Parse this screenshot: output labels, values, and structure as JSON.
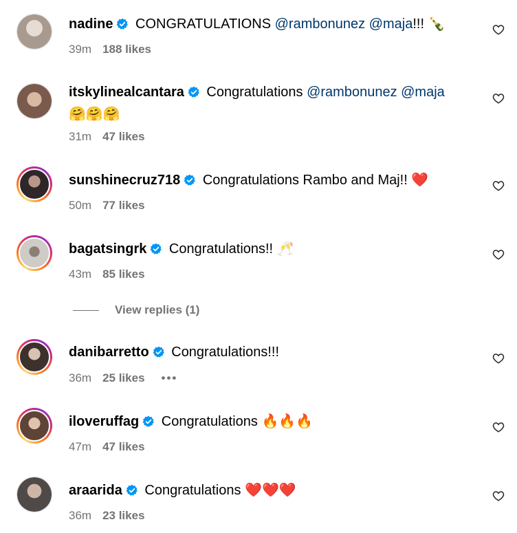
{
  "comments": [
    {
      "username": "nadine",
      "text": " CONGRATULATIONS ",
      "mentions": [
        "@rambonunez",
        "@maja"
      ],
      "suffix": "!!! ",
      "emoji": "🍾",
      "time": "39m",
      "likes": "188 likes",
      "avatar_color": "#c8c2bc"
    },
    {
      "username": "itskylinealcantara",
      "text": " Congratulations ",
      "mentions": [
        "@rambonunez",
        "@maja"
      ],
      "emoji": "🤗🤗🤗",
      "time": "31m",
      "likes": "47 likes",
      "avatar_color": "#9a7b6a"
    },
    {
      "username": "sunshinecruz718",
      "text": " Congratulations Rambo and Maj!! ",
      "emoji": "❤️",
      "time": "50m",
      "likes": "77 likes",
      "avatar_color": "#3a2f33"
    },
    {
      "username": "bagatsingrk",
      "text": " Congratulations!! ",
      "emoji": "🥂",
      "time": "43m",
      "likes": "85 likes",
      "avatar_color": "#bdbab6",
      "view_replies": "View replies (1)"
    },
    {
      "username": "danibarretto",
      "text": " Congratulations!!!",
      "time": "36m",
      "likes": "25 likes",
      "more": "•••",
      "avatar_color": "#4a3a36"
    },
    {
      "username": "iloveruffag",
      "text": " Congratulations ",
      "emoji": "🔥🔥🔥",
      "time": "47m",
      "likes": "47 likes",
      "avatar_color": "#6b4e3f"
    },
    {
      "username": "araarida",
      "text": " Congratulations ",
      "emoji": "❤️❤️❤️",
      "time": "36m",
      "likes": "23 likes",
      "avatar_color": "#5a5553"
    }
  ],
  "colors": {
    "verified": "#0095f6",
    "mention": "#00376b",
    "meta": "#737373"
  }
}
